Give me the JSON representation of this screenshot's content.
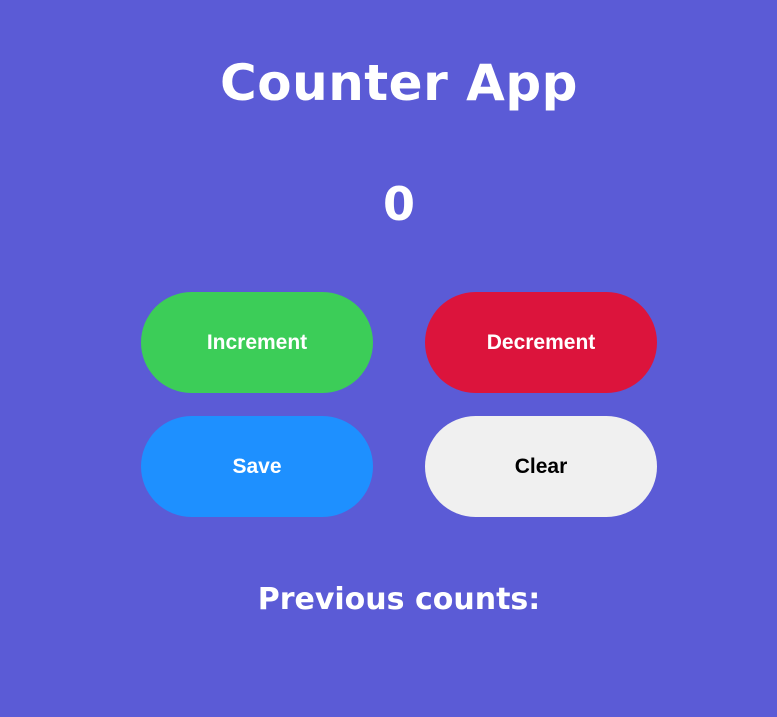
{
  "app": {
    "title": "Counter App",
    "count": "0"
  },
  "buttons": {
    "increment_label": "Increment",
    "decrement_label": "Decrement",
    "save_label": "Save",
    "clear_label": "Clear"
  },
  "history": {
    "label": "Previous counts:",
    "items": []
  },
  "colors": {
    "background": "#5b5bd6",
    "increment": "#3ccd58",
    "decrement": "#dc143c",
    "save": "#1e90ff",
    "clear": "#f0f0f0"
  }
}
